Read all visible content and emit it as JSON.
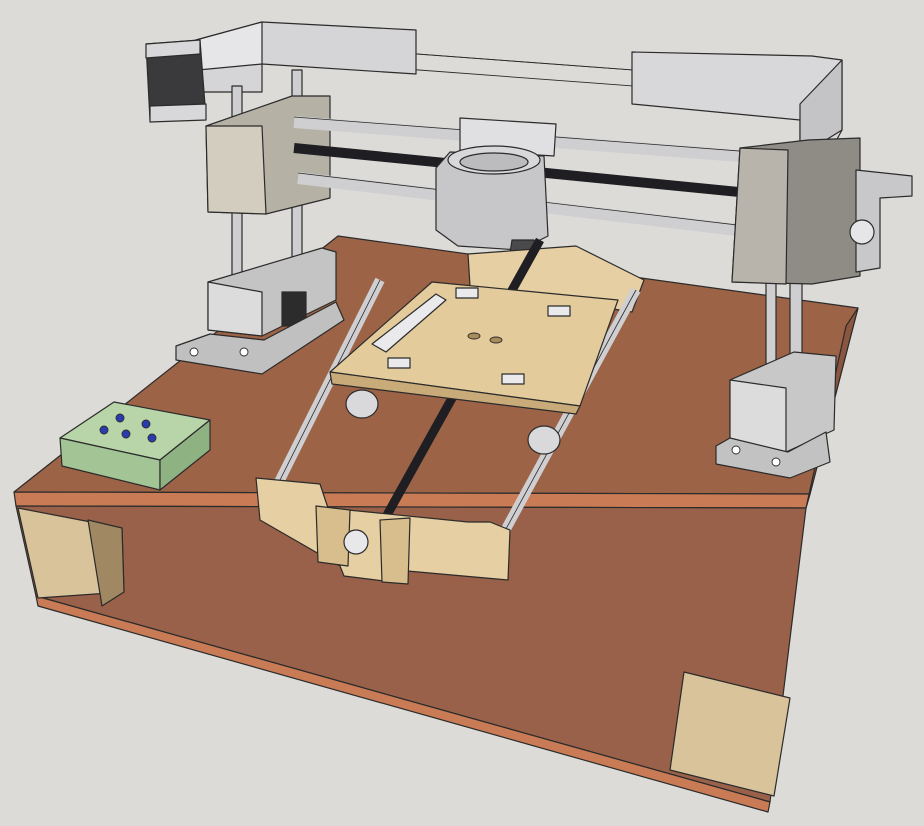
{
  "model_view": {
    "subject": "cartesian-gantry-machine-3d-model",
    "colors": {
      "background": "#dcdbd7",
      "base_top": "#9c6347",
      "base_side": "#9a624a",
      "base_edge_band": "#c87a55",
      "wood_block": "#d8c39a",
      "wood_part": "#e6cfa2",
      "metal_light": "#e4e4e6",
      "metal_mid": "#c6c6c8",
      "metal_dark": "#a0a09e",
      "rod": "#cfcfd2",
      "belt": "#1e1e22",
      "control_box": "#a9cc9c",
      "knob": "#2a3bb0"
    },
    "visible_parts": [
      "base-board",
      "left-tower",
      "right-tower",
      "top-gantry-rail",
      "spindle-carriage",
      "y-axis-table",
      "control-box"
    ]
  }
}
